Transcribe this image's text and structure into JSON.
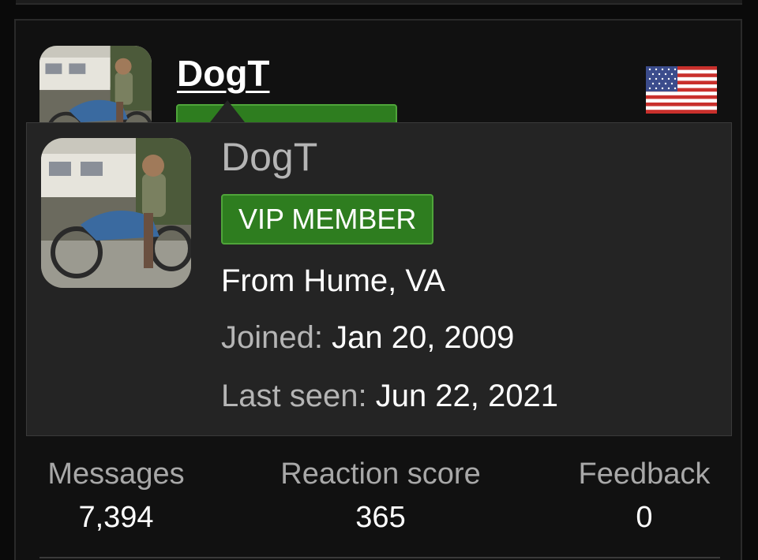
{
  "profile": {
    "username": "DogT",
    "badge": "VIP MEMBER",
    "location": "From Hume, VA",
    "joined_label": "Joined:",
    "joined_value": "Jan 20, 2009",
    "last_seen_label": "Last seen:",
    "last_seen_value": "Jun 22, 2021",
    "flag_icon": "us-flag-icon"
  },
  "stats": [
    {
      "label": "Messages",
      "value": "7,394"
    },
    {
      "label": "Reaction score",
      "value": "365"
    },
    {
      "label": "Feedback",
      "value": "0"
    }
  ],
  "colors": {
    "badge_green": "#2e7d1f",
    "badge_border": "#4fa53a",
    "tooltip_bg": "#242424"
  }
}
